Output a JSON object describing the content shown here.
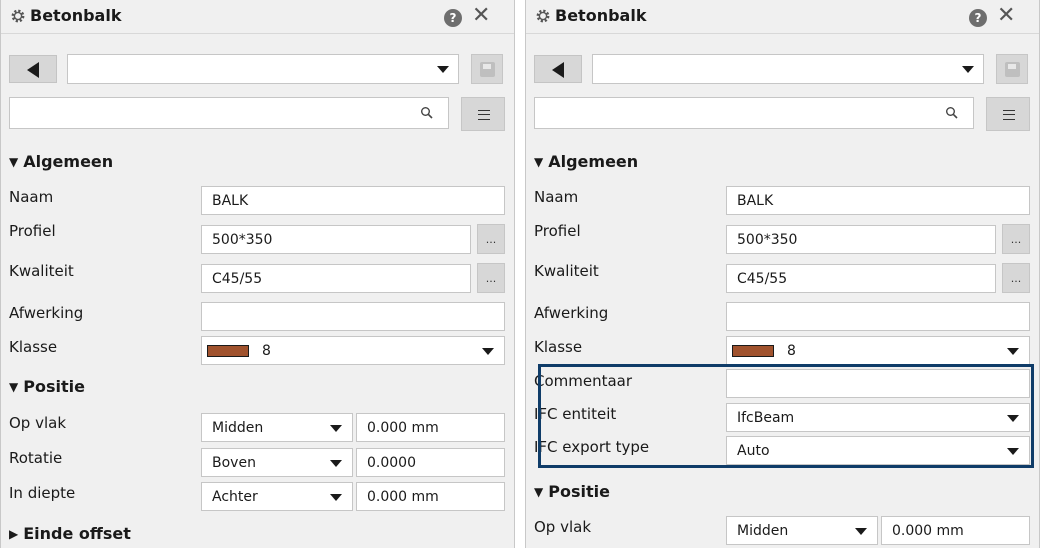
{
  "panels": [
    {
      "title": "Betonbalk",
      "help_label": "?",
      "close_label": "✕",
      "menu_label": "≡",
      "sections": {
        "algemeen": "Algemeen",
        "positie": "Positie",
        "einde_offset": "Einde offset"
      },
      "fields": {
        "naam": {
          "label": "Naam",
          "value": "BALK"
        },
        "profiel": {
          "label": "Profiel",
          "value": "500*350",
          "button": "..."
        },
        "kwaliteit": {
          "label": "Kwaliteit",
          "value": "C45/55",
          "button": "..."
        },
        "afwerking": {
          "label": "Afwerking",
          "value": ""
        },
        "klasse": {
          "label": "Klasse",
          "value": "8",
          "color": "#a0522d"
        },
        "op_vlak": {
          "label": "Op vlak",
          "value": "Midden",
          "offset": "0.000 mm"
        },
        "rotatie": {
          "label": "Rotatie",
          "value": "Boven",
          "offset": "0.0000"
        },
        "in_diepte": {
          "label": "In diepte",
          "value": "Achter",
          "offset": "0.000 mm"
        }
      }
    },
    {
      "title": "Betonbalk",
      "help_label": "?",
      "close_label": "✕",
      "menu_label": "≡",
      "sections": {
        "algemeen": "Algemeen",
        "positie": "Positie"
      },
      "fields": {
        "naam": {
          "label": "Naam",
          "value": "BALK"
        },
        "profiel": {
          "label": "Profiel",
          "value": "500*350",
          "button": "..."
        },
        "kwaliteit": {
          "label": "Kwaliteit",
          "value": "C45/55",
          "button": "..."
        },
        "afwerking": {
          "label": "Afwerking",
          "value": ""
        },
        "klasse": {
          "label": "Klasse",
          "value": "8",
          "color": "#a0522d"
        },
        "commentaar": {
          "label": "Commentaar",
          "value": ""
        },
        "ifc_entiteit": {
          "label": "IFC entiteit",
          "value": "IfcBeam"
        },
        "ifc_export_type": {
          "label": "IFC export type",
          "value": "Auto"
        },
        "op_vlak": {
          "label": "Op vlak",
          "value": "Midden",
          "offset": "0.000 mm"
        }
      }
    }
  ],
  "colors": {
    "highlight_border": "#0f3c68",
    "klasse_swatch": "#a0522d"
  }
}
